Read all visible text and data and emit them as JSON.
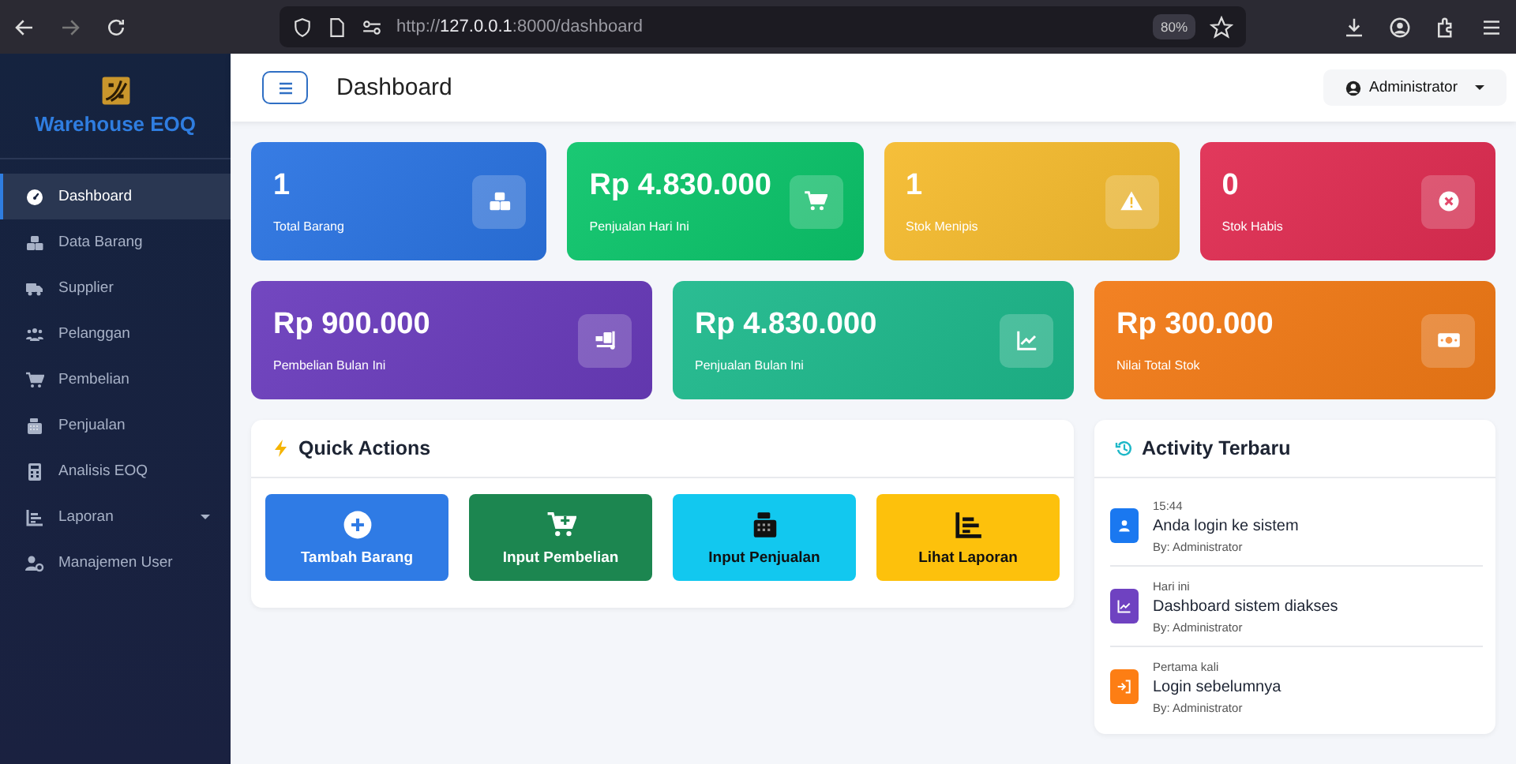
{
  "browser": {
    "url": "http://**127.0.0.1**:8000/dashboard",
    "zoom": "80%"
  },
  "sidebar": {
    "brand": "Warehouse EOQ",
    "items": [
      {
        "label": "Dashboard",
        "kind": "gauge",
        "selected": true,
        "dropdown": false
      },
      {
        "label": "Data Barang",
        "kind": "boxes",
        "selected": false,
        "dropdown": false
      },
      {
        "label": "Supplier",
        "kind": "truck",
        "selected": false,
        "dropdown": false
      },
      {
        "label": "Pelanggan",
        "kind": "users",
        "selected": false,
        "dropdown": false
      },
      {
        "label": "Pembelian",
        "kind": "cart",
        "selected": false,
        "dropdown": false
      },
      {
        "label": "Penjualan",
        "kind": "register",
        "selected": false,
        "dropdown": false
      },
      {
        "label": "Analisis EOQ",
        "kind": "calculator",
        "selected": false,
        "dropdown": false
      },
      {
        "label": "Laporan",
        "kind": "chart",
        "selected": false,
        "dropdown": true
      },
      {
        "label": "Manajemen User",
        "kind": "usergear",
        "selected": false,
        "dropdown": false
      }
    ]
  },
  "header": {
    "title": "Dashboard",
    "user": "Administrator"
  },
  "stats_row_1": [
    {
      "value": "1",
      "label": "Total Barang",
      "color": "#2b74e2",
      "kind": "boxes"
    },
    {
      "value": "Rp 4.830.000",
      "label": "Penjualan Hari Ini",
      "color": "#0cc56b",
      "kind": "cart"
    },
    {
      "value": "1",
      "label": "Stok Menipis",
      "color": "#f5bb2e",
      "kind": "warning"
    },
    {
      "value": "0",
      "label": "Stok Habis",
      "color": "#e02d52",
      "kind": "error"
    }
  ],
  "stats_row_2": [
    {
      "value": "Rp 900.000",
      "label": "Pembelian Bulan Ini",
      "color": "#6a3cbc",
      "kind": "dolly"
    },
    {
      "value": "Rp 4.830.000",
      "label": "Penjualan Bulan Ini",
      "color": "#1eb98c",
      "kind": "trend"
    },
    {
      "value": "Rp 300.000",
      "label": "Nilai Total Stok",
      "color": "#f27a16",
      "kind": "money"
    }
  ],
  "quick_actions": {
    "title": "Quick Actions",
    "buttons": [
      {
        "label": "Tambah Barang",
        "color": "#2f7be5",
        "kind": "add"
      },
      {
        "label": "Input Pembelian",
        "color": "#1c8650",
        "kind": "cartadd"
      },
      {
        "label": "Input Penjualan",
        "color": "#12c8ef",
        "kind": "register"
      },
      {
        "label": "Lihat Laporan",
        "color": "#fdc10c",
        "kind": "chart"
      }
    ]
  },
  "activity": {
    "title": "Activity Terbaru",
    "items": [
      {
        "time": "15:44",
        "text": "Anda login ke sistem",
        "by": "By: Administrator",
        "color": "#1a78f0",
        "kind": "user"
      },
      {
        "time": "Hari ini",
        "text": "Dashboard sistem diakses",
        "by": "By: Administrator",
        "color": "#6f42c1",
        "kind": "trend"
      },
      {
        "time": "Pertama kali",
        "text": "Login sebelumnya",
        "by": "By: Administrator",
        "color": "#fd7e14",
        "kind": "login"
      }
    ]
  }
}
